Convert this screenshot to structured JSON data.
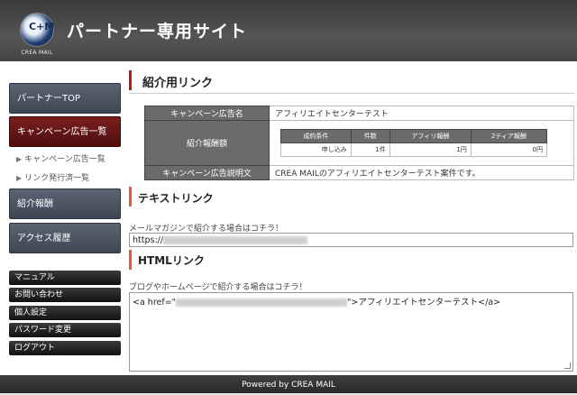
{
  "header": {
    "logo_mark": "C+M",
    "logo_text": "CREA MAIL",
    "title": "パートナー専用サイト"
  },
  "sidebar": {
    "items": [
      {
        "label": "パートナーTOP"
      },
      {
        "label": "キャンペーン広告一覧"
      },
      {
        "label": "紹介報酬"
      },
      {
        "label": "アクセス履歴"
      }
    ],
    "subitems": [
      {
        "label": "キャンペーン広告一覧"
      },
      {
        "label": "リンク発行済一覧"
      }
    ],
    "small_buttons": [
      {
        "label": "マニュアル"
      },
      {
        "label": "お問い合わせ"
      },
      {
        "label": "個人設定"
      },
      {
        "label": "パスワード変更"
      },
      {
        "label": "ログアウト"
      }
    ]
  },
  "main": {
    "title": "紹介用リンク",
    "info": {
      "campaign_name_label": "キャンペーン広告名",
      "campaign_name_value": "アフィリエイトセンターテスト",
      "reward_label": "紹介報酬額",
      "reward_table": {
        "headers": [
          "成約条件",
          "件数",
          "アフィリ報酬",
          "2ティア報酬"
        ],
        "row": [
          "申し込み",
          "1件",
          "1円",
          "0円"
        ]
      },
      "description_label": "キャンペーン広告説明文",
      "description_value": "CREA MAILのアフィリエイトセンターテスト案件です。"
    },
    "text_link": {
      "title": "テキストリンク",
      "hint": "メールマガジンで紹介する場合はコチラ！",
      "value": "https://"
    },
    "html_link": {
      "title": "HTMLリンク",
      "hint": "ブログやホームページで紹介する場合はコチラ！",
      "value_prefix": "<a href=\"",
      "value_suffix": "\">アフィリエイトセンターテスト</a>"
    }
  },
  "footer": {
    "text": "Powered by CREA MAIL"
  },
  "colors": {
    "accent_red": "#b01b1b",
    "accent_orange": "#e8553a",
    "header_dark": "#444444",
    "table_header": "#6b6b6b"
  }
}
